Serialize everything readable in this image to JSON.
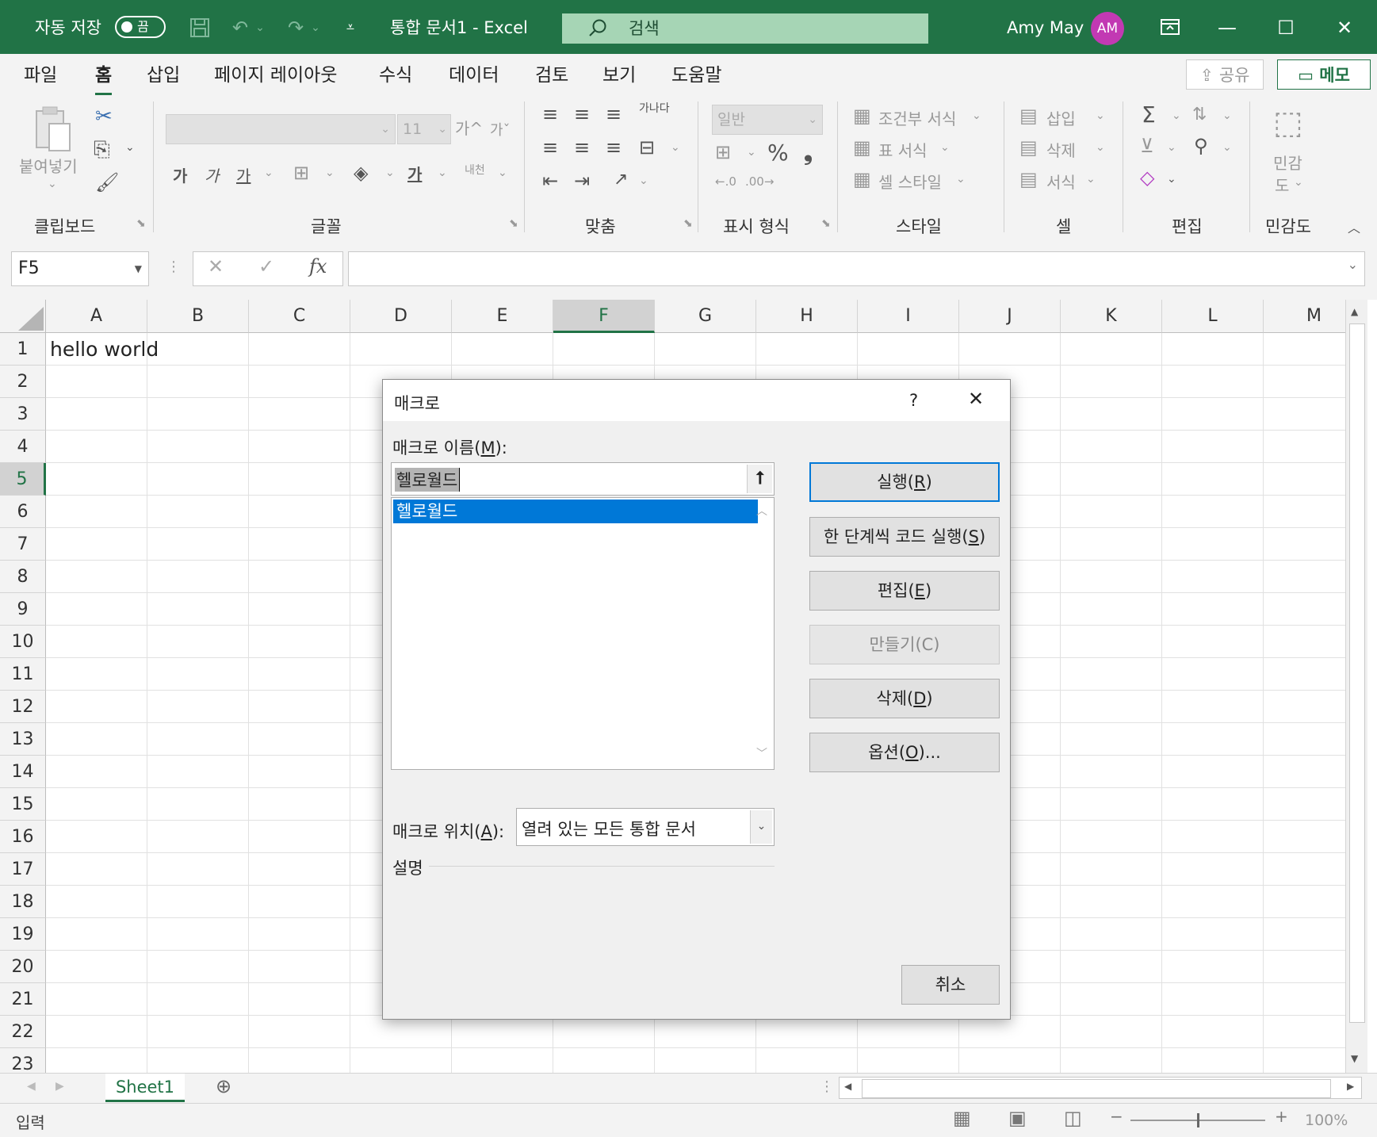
{
  "titlebar": {
    "autosave_label": "자동 저장",
    "autosave_state": "끔",
    "doc_title": "통합 문서1  -  Excel",
    "search_placeholder": "검색",
    "user_name": "Amy May",
    "user_initials": "AM",
    "accent_color": "#217346",
    "avatar_color": "#c239b3"
  },
  "menu": {
    "tabs": [
      "파일",
      "홈",
      "삽입",
      "페이지 레이아웃",
      "수식",
      "데이터",
      "검토",
      "보기",
      "도움말"
    ],
    "active_tab": "홈",
    "share_label": "공유",
    "memo_label": "메모"
  },
  "ribbon": {
    "groups": {
      "clipboard": "클립보드",
      "font": "글꼴",
      "alignment": "맞춤",
      "number": "표시 형식",
      "styles": "스타일",
      "cells": "셀",
      "editing": "편집",
      "sensitivity": "민감도"
    },
    "clipboard": {
      "paste_label": "붙여넣기"
    },
    "font": {
      "size_value": "11",
      "bold": "가",
      "italic": "가",
      "underline": "가",
      "grow": "가^",
      "shrink": "가ˇ",
      "phonetic": "내천"
    },
    "alignment": {
      "wrap": "가나다"
    },
    "number": {
      "format_value": "일반"
    },
    "styles": {
      "conditional": "조건부 서식",
      "table": "표 서식",
      "cell_style": "셀 스타일"
    },
    "cells": {
      "insert": "삽입",
      "delete": "삭제",
      "format": "서식"
    },
    "sensitivity": {
      "label_line1": "민감",
      "label_line2": "도"
    }
  },
  "formula_bar": {
    "name_box": "F5",
    "formula": ""
  },
  "grid": {
    "columns": [
      "A",
      "B",
      "C",
      "D",
      "E",
      "F",
      "G",
      "H",
      "I",
      "J",
      "K",
      "L",
      "M"
    ],
    "rows": [
      "1",
      "2",
      "3",
      "4",
      "5",
      "6",
      "7",
      "8",
      "9",
      "10",
      "11",
      "12",
      "13",
      "14",
      "15",
      "16",
      "17",
      "18",
      "19",
      "20",
      "21",
      "22",
      "23"
    ],
    "selected_column": "F",
    "selected_row": "5",
    "cells": {
      "A1": "hello world"
    }
  },
  "sheets": {
    "tabs": [
      "Sheet1"
    ],
    "active": "Sheet1"
  },
  "statusbar": {
    "mode": "입력",
    "zoom": "100%"
  },
  "dialog": {
    "title": "매크로",
    "help": "?",
    "name_label": "매크로 이름(",
    "name_key": "M",
    "name_label_end": "):",
    "name_value": "헬로월드",
    "list_items": [
      "헬로월드"
    ],
    "selected_item": "헬로월드",
    "buttons": {
      "run": {
        "label": "실행(",
        "key": "R",
        "end": ")"
      },
      "step": {
        "label": "한 단계씩 코드 실행(",
        "key": "S",
        "end": ")"
      },
      "edit": {
        "label": "편집(",
        "key": "E",
        "end": ")"
      },
      "create": {
        "label": "만들기(C)"
      },
      "delete": {
        "label": "삭제(",
        "key": "D",
        "end": ")"
      },
      "options": {
        "label": "옵션(",
        "key": "O",
        "end": ")..."
      },
      "cancel": {
        "label": "취소"
      }
    },
    "location_label": "매크로 위치(",
    "location_key": "A",
    "location_label_end": "):",
    "location_value": "열려 있는 모든 통합 문서",
    "description_label": "설명",
    "selection_color": "#0078d7"
  }
}
